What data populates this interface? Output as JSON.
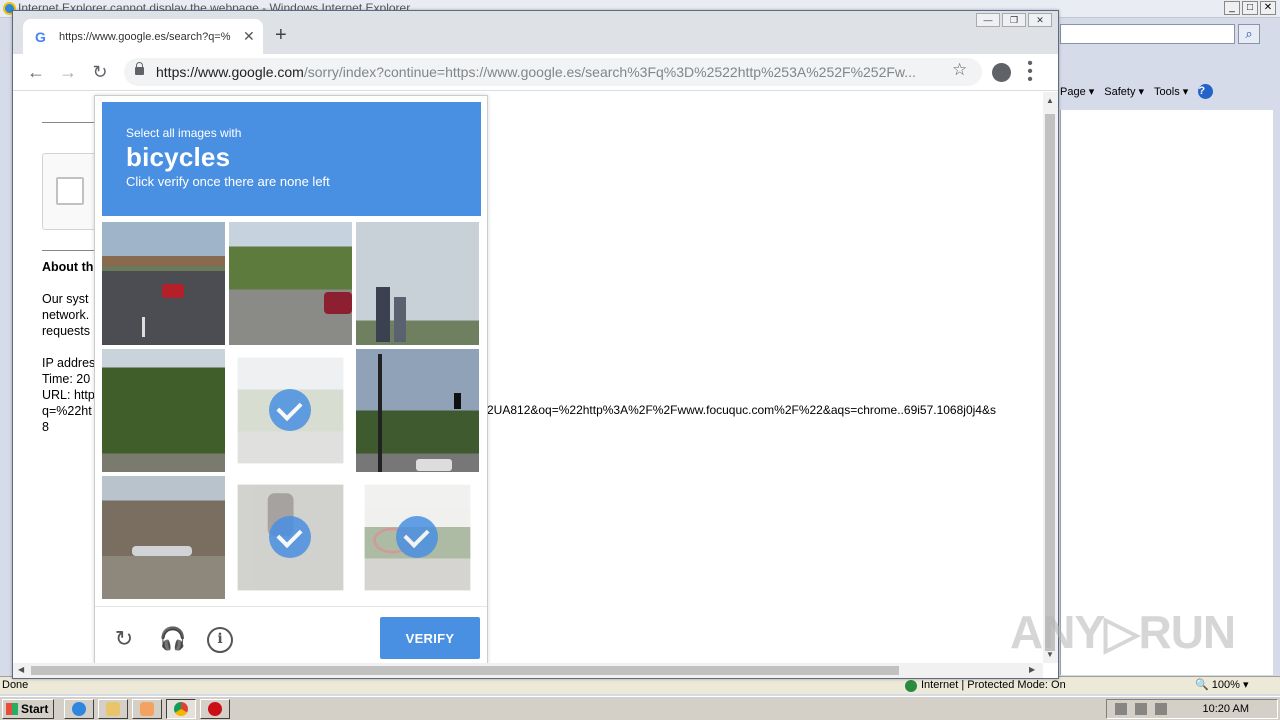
{
  "ie": {
    "title": "Internet Explorer cannot display the webpage - Windows Internet Explorer",
    "title_buttons": [
      "_",
      "□",
      "✕"
    ],
    "command_bar": {
      "page": "Page ▾",
      "safety": "Safety ▾",
      "tools": "Tools ▾",
      "help": "?"
    },
    "status": {
      "done": "Done",
      "zone": "Internet | Protected Mode: On",
      "zoom": "🔍 100% ▾"
    }
  },
  "taskbar": {
    "start_label": "Start",
    "clock": "10:20 AM"
  },
  "chrome": {
    "tab": {
      "favicon": "G",
      "title": "https://www.google.es/search?q=%",
      "close": "✕"
    },
    "new_tab": "+",
    "window_buttons": [
      "—",
      "❐",
      "✕"
    ],
    "nav": {
      "back": "←",
      "forward": "→",
      "reload": "↻"
    },
    "url_host": "https://www.google.com",
    "url_path": "/sorry/index?continue=https://www.google.es/search%3Fq%3D%2522http%253A%252F%252Fw...",
    "star": "☆"
  },
  "page": {
    "about_heading": "About th",
    "lines_a": [
      "Our syst",
      "network.",
      "requests"
    ],
    "lines_b": [
      "IP addres",
      "Time: 20",
      "URL: http",
      "q=%22ht",
      "8"
    ],
    "url_tail": "2UA812&oq=%22http%3A%2F%2Fwww.focuquc.com%2F%22&aqs=chrome..69i57.1068j0j4&s"
  },
  "captcha": {
    "small": "Select all images with",
    "big": "bicycles",
    "sub": "Click verify once there are none left",
    "verify_label": "VERIFY",
    "tiles": [
      {
        "scene": "highway",
        "selected": false
      },
      {
        "scene": "street-trees",
        "selected": false
      },
      {
        "scene": "towers",
        "selected": false
      },
      {
        "scene": "tree-house",
        "selected": false
      },
      {
        "scene": "bicycle-path",
        "selected": true
      },
      {
        "scene": "traffic-light",
        "selected": false
      },
      {
        "scene": "house-car",
        "selected": false
      },
      {
        "scene": "cyclist",
        "selected": true
      },
      {
        "scene": "bike-rack",
        "selected": true
      }
    ],
    "icons": {
      "reload": "↻",
      "audio": "🎧",
      "info": "i"
    }
  },
  "watermark": "ANY▷RUN",
  "colors": {
    "captcha_blue": "#4a90e2",
    "chrome_tabstrip": "#dee1e6"
  }
}
